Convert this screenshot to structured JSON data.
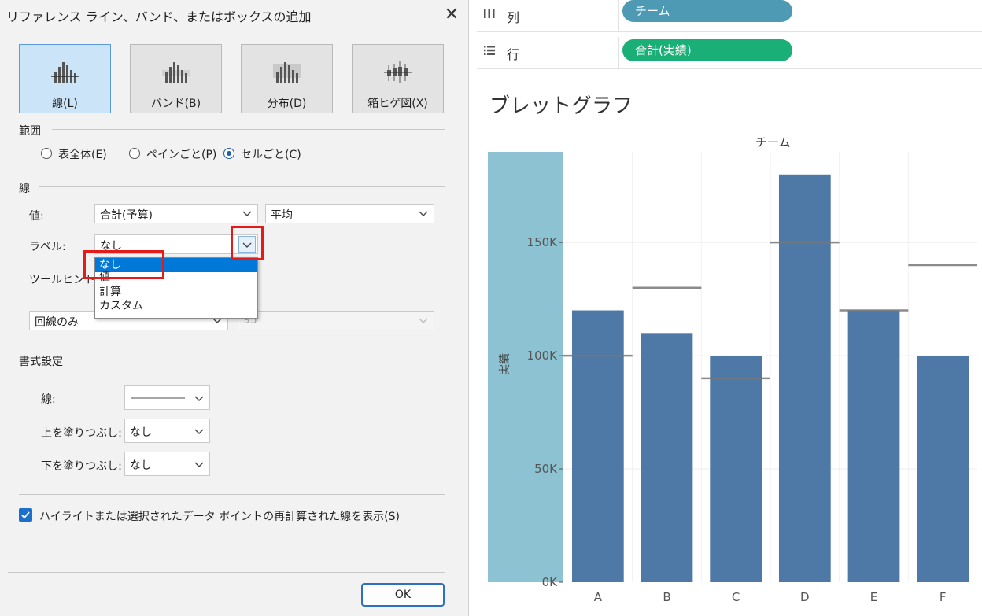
{
  "dialog": {
    "title": "リファレンス ライン、バンド、またはボックスの追加",
    "close_glyph": "✕",
    "types": [
      {
        "label": "線(L)",
        "active": true
      },
      {
        "label": "バンド(B)",
        "active": false
      },
      {
        "label": "分布(D)",
        "active": false
      },
      {
        "label": "箱ヒゲ図(X)",
        "active": false
      }
    ],
    "scope": {
      "header": "範囲",
      "options": [
        {
          "label": "表全体(E)",
          "selected": false
        },
        {
          "label": "ペインごと(P)",
          "selected": false
        },
        {
          "label": "セルごと(C)",
          "selected": true
        }
      ]
    },
    "line": {
      "header": "線",
      "value_label": "値:",
      "value_field": "合計(予算)",
      "aggregation": "平均",
      "label_label": "ラベル:",
      "label_value": "なし",
      "tooltip_label": "ツールヒント:",
      "label_options": [
        "なし",
        "値",
        "計算",
        "カスタム"
      ],
      "display_mode": "回線のみ",
      "confidence": "95"
    },
    "format": {
      "header": "書式設定",
      "line_label": "線:",
      "fill_above_label": "上を塗りつぶし:",
      "fill_above_value": "なし",
      "fill_below_label": "下を塗りつぶし:",
      "fill_below_value": "なし"
    },
    "checkbox_label": "ハイライトまたは選択されたデータ ポイントの再計算された線を表示(S)",
    "checkbox_checked": true,
    "ok_label": "OK"
  },
  "shelves": {
    "columns_label": "列",
    "columns_pill": "チーム",
    "columns_pill_color": "#4e9ab4",
    "rows_label": "行",
    "rows_pill": "合計(実績)",
    "rows_pill_color": "#1aaf77"
  },
  "sheet_title": "ブレットグラフ",
  "chart_data": {
    "type": "bar",
    "title": "ブレットグラフ",
    "column_header": "チーム",
    "categories": [
      "A",
      "B",
      "C",
      "D",
      "E",
      "F"
    ],
    "series": [
      {
        "name": "合計(実績)",
        "values": [
          120000,
          110000,
          100000,
          180000,
          120000,
          100000
        ]
      }
    ],
    "reference_lines": [
      100000,
      130000,
      90000,
      150000,
      120000,
      140000
    ],
    "ylabel": "実績",
    "yticks": [
      "0K",
      "50K",
      "100K",
      "150K"
    ],
    "ylim": [
      0,
      190000
    ],
    "bar_color": "#4e79a7",
    "highlight_color": "#8cc2d1",
    "grid": true
  }
}
